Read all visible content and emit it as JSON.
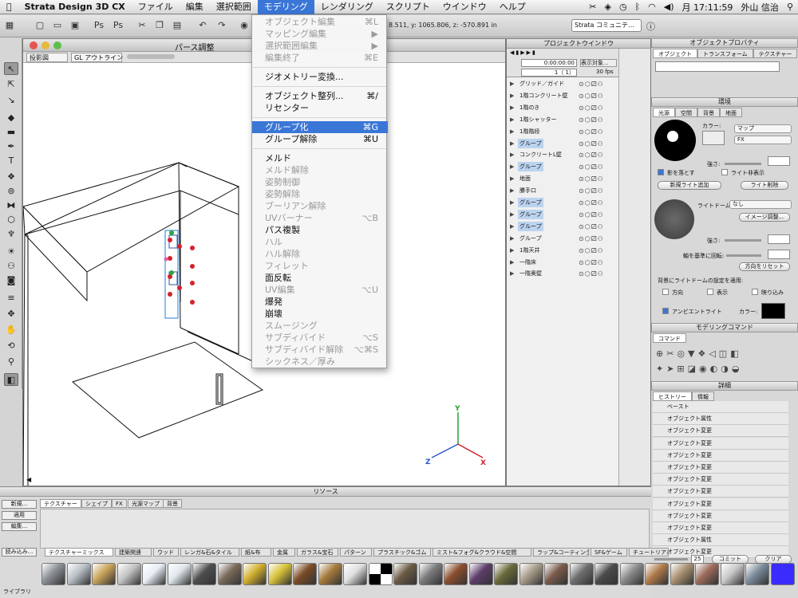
{
  "menubar": {
    "app": "Strata Design 3D CX",
    "items": [
      "ファイル",
      "編集",
      "選択範囲",
      "モデリング",
      "レンダリング",
      "スクリプト",
      "ウインドウ",
      "ヘルプ"
    ],
    "clock": "月 17:11:59",
    "user": "外山 信治"
  },
  "toolbar": {
    "coords": "8.511, y: 1065.806, z: -570.891 in",
    "strata_select": "Strata コミュニテ…"
  },
  "document": {
    "title": "パース調整",
    "view_mode": "投影図",
    "render_mode": "GL アウトライン"
  },
  "modeling_menu": {
    "items": [
      {
        "label": "オブジェクト編集",
        "shortcut": "⌘L",
        "disabled": true
      },
      {
        "label": "マッピング編集",
        "shortcut": "▶",
        "disabled": true
      },
      {
        "label": "選択範囲編集",
        "shortcut": "▶",
        "disabled": true
      },
      {
        "label": "編集終了",
        "shortcut": "⌘E",
        "disabled": true
      },
      {
        "label": "ジオメトリー変換...",
        "shortcut": "",
        "disabled": false
      },
      {
        "label": "オブジェクト整列...",
        "shortcut": "⌘/",
        "disabled": false
      },
      {
        "label": "リセンター",
        "shortcut": "",
        "disabled": false
      },
      {
        "label": "グループ化",
        "shortcut": "⌘G",
        "disabled": false,
        "highlighted": true
      },
      {
        "label": "グループ解除",
        "shortcut": "⌘U",
        "disabled": false
      },
      {
        "label": "メルド",
        "shortcut": "",
        "disabled": false
      },
      {
        "label": "メルド解除",
        "shortcut": "",
        "disabled": true
      },
      {
        "label": "姿勢制御",
        "shortcut": "",
        "disabled": true
      },
      {
        "label": "姿勢解除",
        "shortcut": "",
        "disabled": true
      },
      {
        "label": "ブーリアン解除",
        "shortcut": "",
        "disabled": true
      },
      {
        "label": "UVバーナー",
        "shortcut": "⌥B",
        "disabled": true
      },
      {
        "label": "パス複製",
        "shortcut": "",
        "disabled": false
      },
      {
        "label": "ハル",
        "shortcut": "",
        "disabled": true
      },
      {
        "label": "ハル解除",
        "shortcut": "",
        "disabled": true
      },
      {
        "label": "フィレット",
        "shortcut": "",
        "disabled": true
      },
      {
        "label": "面反転",
        "shortcut": "",
        "disabled": false
      },
      {
        "label": "UV編集",
        "shortcut": "⌥U",
        "disabled": true
      },
      {
        "label": "爆発",
        "shortcut": "",
        "disabled": false
      },
      {
        "label": "崩壊",
        "shortcut": "",
        "disabled": false
      },
      {
        "label": "スムージング",
        "shortcut": "",
        "disabled": true
      },
      {
        "label": "サブディバイド",
        "shortcut": "⌥S",
        "disabled": true
      },
      {
        "label": "サブディバイド解除",
        "shortcut": "⌥⌘S",
        "disabled": true
      },
      {
        "label": "シックネス／厚み",
        "shortcut": "",
        "disabled": true
      }
    ]
  },
  "project": {
    "title": "プロジェクトウインドウ",
    "timecode": "0:00:00:00",
    "frame": "1（ 1）",
    "display": "表示対象...",
    "fps": "30 fps",
    "rows": [
      {
        "name": "グリッド／ガイド",
        "group": false
      },
      {
        "name": "1階コンクリート壁",
        "group": false
      },
      {
        "name": "1階のき",
        "group": false
      },
      {
        "name": "1階シャッター",
        "group": false
      },
      {
        "name": "1階階段",
        "group": false
      },
      {
        "name": "グループ",
        "group": true
      },
      {
        "name": "コンクリートL壁",
        "group": false
      },
      {
        "name": "グループ",
        "group": true
      },
      {
        "name": "地面",
        "group": false
      },
      {
        "name": "勝手口",
        "group": false
      },
      {
        "name": "グループ",
        "group": true
      },
      {
        "name": "グループ",
        "group": true
      },
      {
        "name": "グループ",
        "group": true
      },
      {
        "name": "グループ",
        "group": false
      },
      {
        "name": "1階天井",
        "group": false
      },
      {
        "name": "一階床",
        "group": false
      },
      {
        "name": "一階奥壁",
        "group": false
      }
    ]
  },
  "object_props": {
    "title": "オブジェクトプロパティ",
    "tabs": [
      "オブジェクト",
      "トランスフォーム",
      "テクスチャー"
    ]
  },
  "environment": {
    "title": "環境",
    "tabs": [
      "光源",
      "空間",
      "背景",
      "地面"
    ],
    "color_label": "カラー:",
    "map_select": "マップ",
    "fx_select": "FX",
    "strength_label": "強さ:",
    "cast_shadow": "影を落とす",
    "light_hidden": "ライト非表示",
    "add_light": "新規ライト追加",
    "delete_light": "ライト削除",
    "light_dome_label": "ライトドーム:",
    "light_dome_value": "なし",
    "image_adjust": "イメージ調整...",
    "strength2_label": "強さ:",
    "axis_rotate_label": "軸を基準に回転:",
    "reset_direction": "方向をリセット",
    "bg_apply_label": "背景にライトドームの設定を適用:",
    "opt_direction": "方向",
    "opt_display": "表示",
    "opt_reflect": "映り込み",
    "ambient_light": "アンビエントライト",
    "ambient_color_label": "カラー:"
  },
  "modeling_commands": {
    "title": "モデリングコマンド",
    "tab": "コマンド"
  },
  "details": {
    "title": "詳細",
    "tabs": [
      "ヒストリー",
      "情報"
    ],
    "history": [
      "ベースト",
      "オブジェクト属性",
      "オブジェクト変更",
      "オブジェクト変更",
      "オブジェクト変更",
      "オブジェクト変更",
      "オブジェクト変更",
      "オブジェクト変更",
      "オブジェクト変更",
      "オブジェクト変更",
      "オブジェクト変更",
      "オブジェクト属性",
      "オブジェクト変更"
    ],
    "history_count": "25",
    "commit": "コミット",
    "clear": "クリア"
  },
  "resources": {
    "title": "リソース",
    "tabs": [
      "テクスチャー",
      "シェイプ",
      "FX",
      "光源マップ",
      "背景"
    ],
    "new_btn": "新規...",
    "apply_btn": "適用",
    "edit_btn": "編集...",
    "load_btn": "読み込み...",
    "library": "ライブラリ",
    "categories": [
      "テクスチャーミックス",
      "建築関連",
      "ウッド",
      "レンガ&石&タイル",
      "紙&布",
      "金属",
      "ガラス&宝石",
      "パターン",
      "プラスチック&ゴム",
      "ミスト&フォグ&クラウド&空間",
      "ラップ&コーティング",
      "SF&ゲーム",
      "チュートリアル"
    ]
  },
  "colors": {
    "accent": "#3a76d6",
    "group_highlight": "#bcd3f0"
  }
}
